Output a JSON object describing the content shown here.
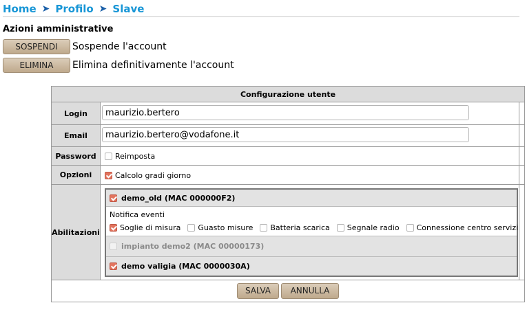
{
  "breadcrumb": {
    "items": [
      "Home",
      "Profilo",
      "Slave"
    ],
    "separator": "➤"
  },
  "admin": {
    "title": "Azioni amministrative",
    "suspend": {
      "button": "SOSPENDI",
      "desc": "Sospende l'account"
    },
    "delete": {
      "button": "ELIMINA",
      "desc": "Elimina definitivamente l'account"
    }
  },
  "config": {
    "title": "Configurazione utente",
    "login": {
      "label": "Login",
      "value": "maurizio.bertero"
    },
    "email": {
      "label": "Email",
      "value": "maurizio.bertero@vodafone.it"
    },
    "password": {
      "label": "Password",
      "reset_label": "Reimposta",
      "reset_checked": false
    },
    "options": {
      "label": "Opzioni",
      "degree_days_label": "Calcolo gradi giorno",
      "degree_days_checked": true
    },
    "enablements": {
      "label": "Abilitazioni",
      "plants": [
        {
          "name": "demo_old (MAC 000000F2)",
          "checked": true,
          "disabled": false
        },
        {
          "name": "impianto demo2 (MAC 00000173)",
          "checked": false,
          "disabled": true
        },
        {
          "name": "demo valigia (MAC 0000030A)",
          "checked": true,
          "disabled": false
        }
      ],
      "notifications": {
        "title": "Notifica eventi",
        "options": [
          {
            "label": "Soglie di misura",
            "checked": true
          },
          {
            "label": "Guasto misure",
            "checked": false
          },
          {
            "label": "Batteria scarica",
            "checked": false
          },
          {
            "label": "Segnale radio",
            "checked": false
          },
          {
            "label": "Connessione centro servizi",
            "checked": false
          }
        ]
      }
    },
    "save": "SALVA",
    "cancel": "ANNULLA"
  },
  "colors": {
    "link": "#1896d6",
    "checkbox_checked": "#e2735d",
    "button": "#c9b69c"
  }
}
